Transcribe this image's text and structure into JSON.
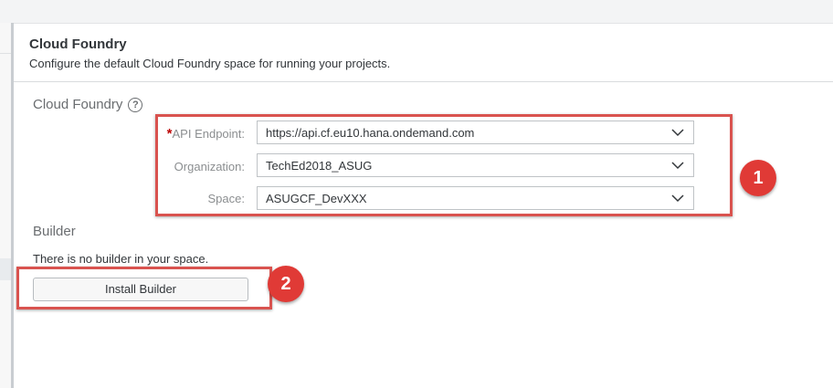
{
  "header": {
    "title": "Cloud Foundry",
    "subtitle": "Configure the default Cloud Foundry space for running your projects."
  },
  "section": {
    "title": "Cloud Foundry",
    "help_icon": "question-circle-icon"
  },
  "fields": {
    "api_endpoint": {
      "label": "API Endpoint:",
      "required_mark": "*",
      "value": "https://api.cf.eu10.hana.ondemand.com"
    },
    "organization": {
      "label": "Organization:",
      "value": "TechEd2018_ASUG"
    },
    "space": {
      "label": "Space:",
      "value": "ASUGCF_DevXXX"
    }
  },
  "builder": {
    "title": "Builder",
    "message": "There is no builder in your space.",
    "install_label": "Install Builder"
  },
  "annotations": {
    "badge_1": "1",
    "badge_2": "2",
    "highlight_color": "#d9534f",
    "badge_color": "#e03a36"
  }
}
